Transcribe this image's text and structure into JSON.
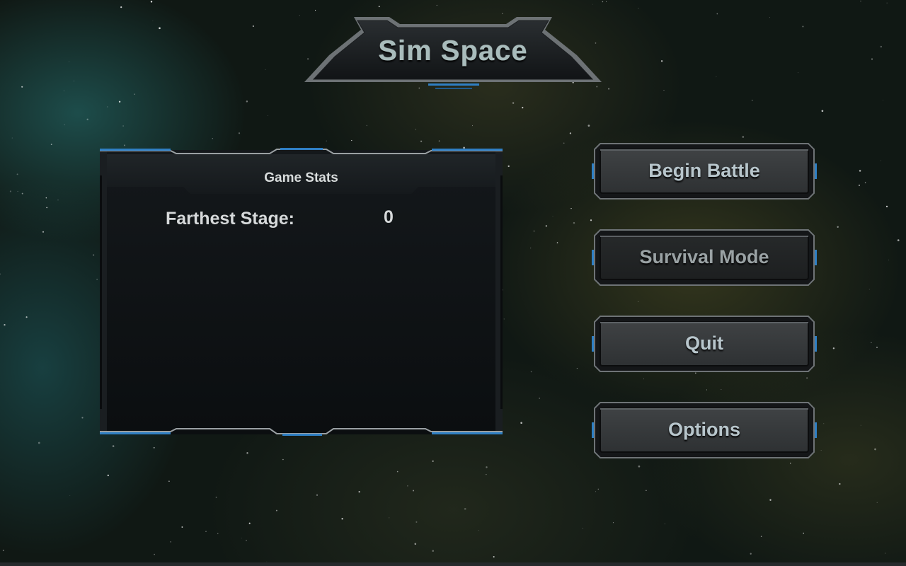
{
  "game": {
    "title": "Sim Space"
  },
  "stats_panel": {
    "header": "Game Stats",
    "rows": [
      {
        "label": "Farthest Stage:",
        "value": "0"
      }
    ]
  },
  "menu": {
    "buttons": [
      {
        "label": "Begin Battle",
        "enabled": true
      },
      {
        "label": "Survival Mode",
        "enabled": false
      },
      {
        "label": "Quit",
        "enabled": true
      },
      {
        "label": "Options",
        "enabled": true
      }
    ]
  },
  "colors": {
    "accent_blue": "#2f7fc4",
    "panel_dark": "#0c0f12",
    "button_face": "#3c3f40",
    "text_light": "#d6d9da"
  }
}
